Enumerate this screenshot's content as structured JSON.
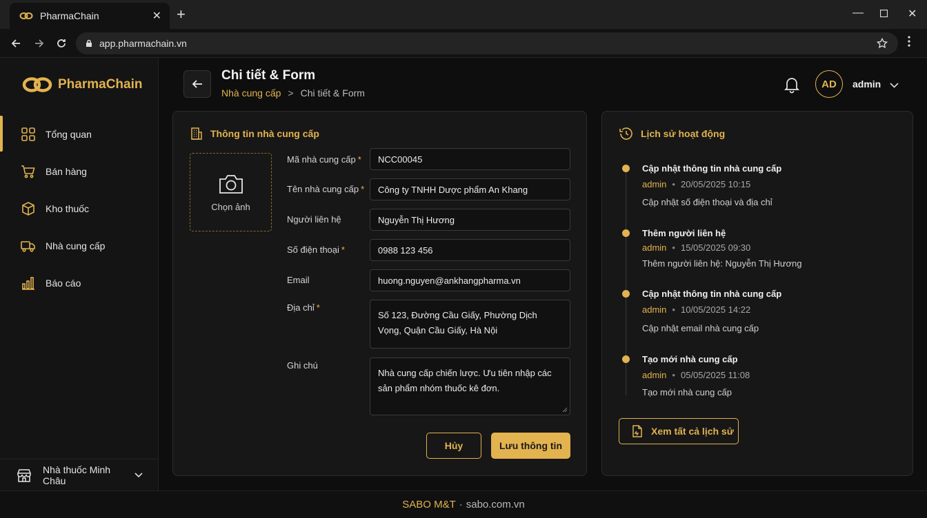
{
  "browser": {
    "tab_title": "PharmaChain",
    "url": "app.pharmachain.vn"
  },
  "sidebar": {
    "brand": "PharmaChain",
    "items": [
      {
        "label": "Tổng quan",
        "icon": "grid-icon",
        "active": true
      },
      {
        "label": "Bán hàng",
        "icon": "cart-icon"
      },
      {
        "label": "Kho thuốc",
        "icon": "box-icon"
      },
      {
        "label": "Nhà cung cấp",
        "icon": "truck-icon"
      },
      {
        "label": "Báo cáo",
        "icon": "bar-chart-icon"
      }
    ],
    "store": "Nhà thuốc Minh Châu"
  },
  "header": {
    "title": "Chi tiết & Form",
    "breadcrumb": {
      "parent": "Nhà cung cấp",
      "separator": ">",
      "current": "Chi tiết & Form"
    },
    "avatar_initials": "AD",
    "username": "admin"
  },
  "form": {
    "title": "Thông tin nhà cung cấp",
    "photo_label": "Chọn ảnh",
    "fields": {
      "code": {
        "label": "Mã nhà cung cấp",
        "required": "*",
        "value": "NCC00045"
      },
      "name": {
        "label": "Tên nhà cung cấp",
        "required": "*",
        "value": "Công ty TNHH Dược phẩm An Khang"
      },
      "contact": {
        "label": "Người liên hệ",
        "value": "Nguyễn Thị Hương"
      },
      "phone": {
        "label": "Số điện thoại",
        "required": "*",
        "value": "0988 123 456"
      },
      "email": {
        "label": "Email",
        "value": "huong.nguyen@ankhangpharma.vn"
      },
      "address": {
        "label": "Địa chỉ",
        "required": "*",
        "value": "Số 123, Đường Cầu Giấy, Phường Dịch Vọng, Quận Cầu Giấy, Hà Nội"
      },
      "note": {
        "label": "Ghi chú",
        "value": "Nhà cung cấp chiến lược. Ưu tiên nhập các sản phẩm nhóm thuốc kê đơn."
      }
    },
    "cancel_label": "Hủy",
    "save_label": "Lưu thông tin"
  },
  "history": {
    "title": "Lịch sử hoạt động",
    "items": [
      {
        "title": "Cập nhật thông tin nhà cung cấp",
        "user": "admin",
        "sep": "•",
        "time": "20/05/2025 10:15",
        "desc": "Cập nhật số điện thoại và địa chỉ"
      },
      {
        "title": "Thêm người liên hệ",
        "user": "admin",
        "sep": "•",
        "time": "15/05/2025 09:30",
        "desc": "Thêm người liên hệ: Nguyễn Thị Hương"
      },
      {
        "title": "Cập nhật thông tin nhà cung cấp",
        "user": "admin",
        "sep": "•",
        "time": "10/05/2025 14:22",
        "desc": "Cập nhật email nhà cung cấp"
      },
      {
        "title": "Tạo mới nhà cung cấp",
        "user": "admin",
        "sep": "•",
        "time": "05/05/2025 11:08",
        "desc": "Tạo mới nhà cung cấp"
      }
    ],
    "view_all_label": "Xem tất cả lịch sử"
  },
  "footer": {
    "brand": "SABO M&T",
    "separator": "·",
    "site": "sabo.com.vn"
  },
  "colors": {
    "accent": "#e3b34f",
    "background": "#0e0e0e",
    "card": "#171717"
  }
}
